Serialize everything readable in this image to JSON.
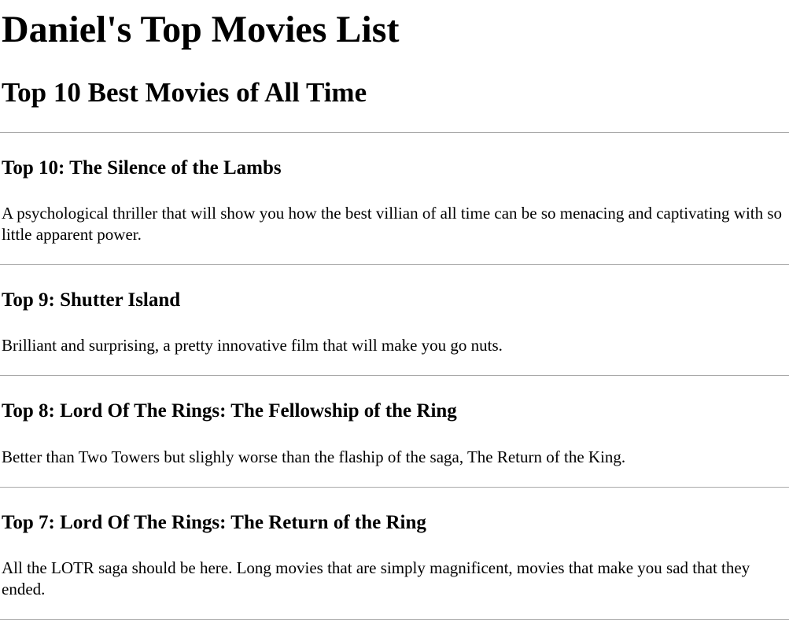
{
  "page": {
    "title": "Daniel's Top Movies List",
    "subtitle": "Top 10 Best Movies of All Time"
  },
  "movies": [
    {
      "heading": "Top 10: The Silence of the Lambs",
      "description": "A psychological thriller that will show you how the best villian of all time can be so menacing and captivating with so little apparent power."
    },
    {
      "heading": "Top 9: Shutter Island",
      "description": "Brilliant and surprising, a pretty innovative film that will make you go nuts."
    },
    {
      "heading": "Top 8: Lord Of The Rings: The Fellowship of the Ring",
      "description": "Better than Two Towers but slighly worse than the flaship of the saga, The Return of the King."
    },
    {
      "heading": "Top 7: Lord Of The Rings: The Return of the Ring",
      "description": "All the LOTR saga should be here. Long movies that are simply magnificent, movies that make you sad that they ended."
    }
  ],
  "colors": {
    "text": "#000000",
    "rule": "#a9a9a9",
    "background": "#ffffff"
  }
}
